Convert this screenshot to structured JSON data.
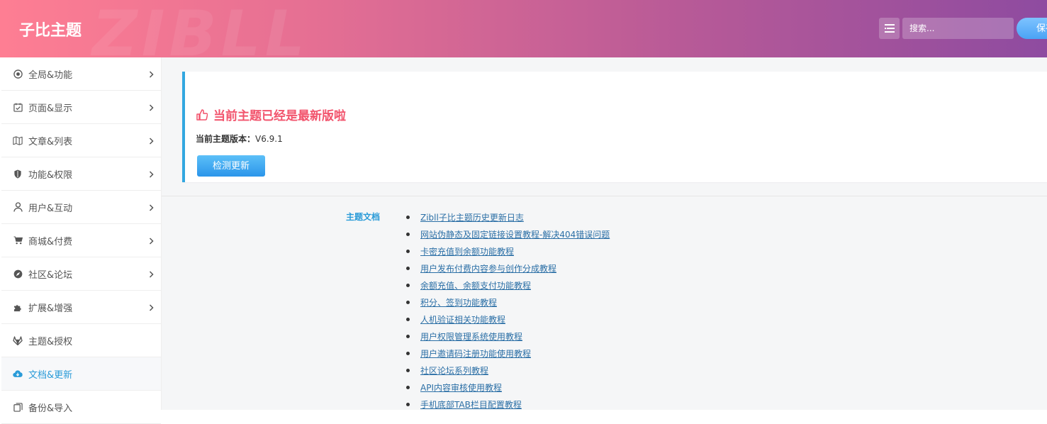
{
  "header": {
    "brand": "子比主题",
    "watermark": "ZIBLL",
    "search_placeholder": "搜索...",
    "save_label": "保存"
  },
  "sidebar": {
    "items": [
      {
        "label": "全局&功能",
        "icon": "target-icon",
        "chevron": true,
        "active": false
      },
      {
        "label": "页面&显示",
        "icon": "calendar-check-icon",
        "chevron": true,
        "active": false
      },
      {
        "label": "文章&列表",
        "icon": "map-icon",
        "chevron": true,
        "active": false
      },
      {
        "label": "功能&权限",
        "icon": "shield-icon",
        "chevron": true,
        "active": false
      },
      {
        "label": "用户&互动",
        "icon": "user-icon",
        "chevron": true,
        "active": false
      },
      {
        "label": "商城&付费",
        "icon": "cart-icon",
        "chevron": true,
        "active": false
      },
      {
        "label": "社区&论坛",
        "icon": "compass-icon",
        "chevron": true,
        "active": false
      },
      {
        "label": "扩展&增强",
        "icon": "puzzle-icon",
        "chevron": true,
        "active": false
      },
      {
        "label": "主题&授权",
        "icon": "gitlab-icon",
        "chevron": false,
        "active": false
      },
      {
        "label": "文档&更新",
        "icon": "cloud-download-icon",
        "chevron": false,
        "active": true
      },
      {
        "label": "备份&导入",
        "icon": "copy-icon",
        "chevron": false,
        "active": false
      }
    ]
  },
  "update": {
    "title": "当前主题已经是最新版啦",
    "version_label": "当前主题版本：",
    "version_value": "V6.9.1",
    "check_button": "检测更新"
  },
  "docs": {
    "label": "主题文档",
    "links": [
      "Zibll子比主题历史更新日志",
      "网站伪静态及固定链接设置教程-解决404错误问题",
      "卡密充值到余额功能教程",
      "用户发布付费内容参与创作分成教程",
      "余额充值、余额支付功能教程",
      "积分、签到功能教程",
      "人机验证相关功能教程",
      "用户权限管理系统使用教程",
      "用户邀请码注册功能使用教程",
      "社区论坛系列教程",
      "API内容审核使用教程",
      "手机底部TAB栏目配置教程"
    ]
  },
  "colors": {
    "accent": "#2a9bd8",
    "title_red": "#f2546d",
    "header_start": "#fe7e93",
    "header_end": "#8e4ba0"
  }
}
